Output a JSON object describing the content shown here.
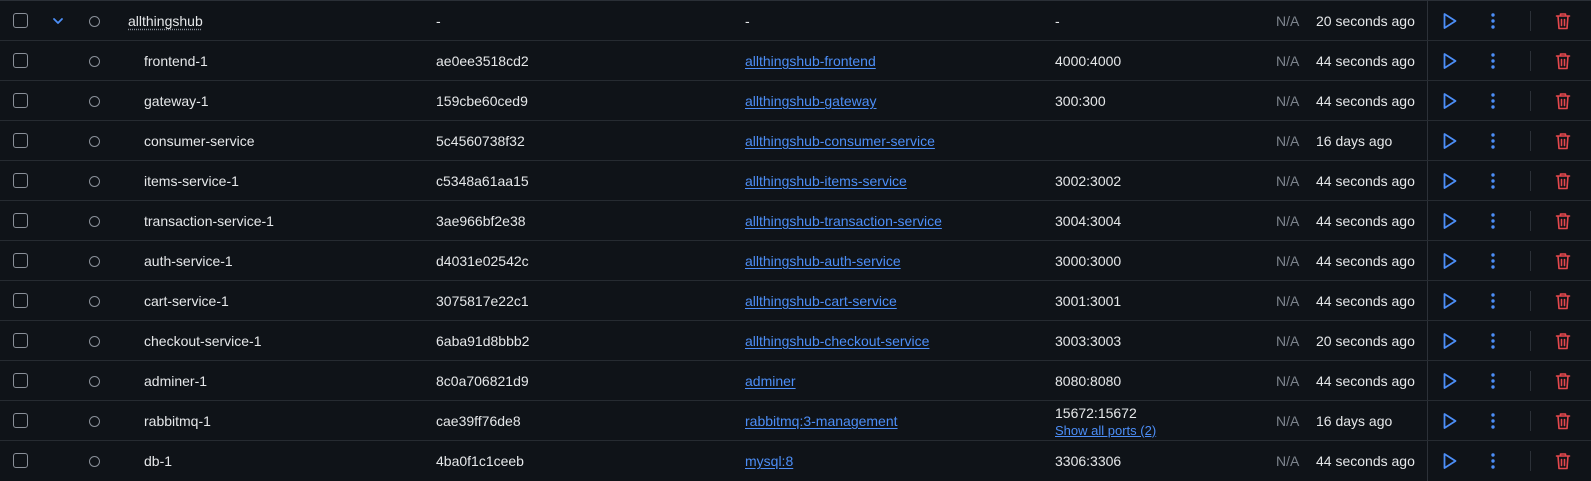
{
  "colors": {
    "background": "#0f1318",
    "link": "#4c8ef7",
    "play_icon": "#4c8ef7",
    "delete_icon": "#e5484d",
    "muted": "#7d848d"
  },
  "rows": [
    {
      "name": "allthingshub",
      "container_id": "-",
      "image": "-",
      "image_is_link": false,
      "ports": "-",
      "show_all_ports": "",
      "cpu": "N/A",
      "created": "20 seconds ago",
      "is_group": true
    },
    {
      "name": "frontend-1",
      "container_id": "ae0ee3518cd2",
      "image": "allthingshub-frontend",
      "image_is_link": true,
      "ports": "4000:4000",
      "show_all_ports": "",
      "cpu": "N/A",
      "created": "44 seconds ago",
      "is_group": false
    },
    {
      "name": "gateway-1",
      "container_id": "159cbe60ced9",
      "image": "allthingshub-gateway",
      "image_is_link": true,
      "ports": "300:300",
      "show_all_ports": "",
      "cpu": "N/A",
      "created": "44 seconds ago",
      "is_group": false
    },
    {
      "name": "consumer-service",
      "container_id": "5c4560738f32",
      "image": "allthingshub-consumer-service",
      "image_is_link": true,
      "ports": "",
      "show_all_ports": "",
      "cpu": "N/A",
      "created": "16 days ago",
      "is_group": false
    },
    {
      "name": "items-service-1",
      "container_id": "c5348a61aa15",
      "image": "allthingshub-items-service",
      "image_is_link": true,
      "ports": "3002:3002",
      "show_all_ports": "",
      "cpu": "N/A",
      "created": "44 seconds ago",
      "is_group": false
    },
    {
      "name": "transaction-service-1",
      "container_id": "3ae966bf2e38",
      "image": "allthingshub-transaction-service",
      "image_is_link": true,
      "ports": "3004:3004",
      "show_all_ports": "",
      "cpu": "N/A",
      "created": "44 seconds ago",
      "is_group": false
    },
    {
      "name": "auth-service-1",
      "container_id": "d4031e02542c",
      "image": "allthingshub-auth-service",
      "image_is_link": true,
      "ports": "3000:3000",
      "show_all_ports": "",
      "cpu": "N/A",
      "created": "44 seconds ago",
      "is_group": false
    },
    {
      "name": "cart-service-1",
      "container_id": "3075817e22c1",
      "image": "allthingshub-cart-service",
      "image_is_link": true,
      "ports": "3001:3001",
      "show_all_ports": "",
      "cpu": "N/A",
      "created": "44 seconds ago",
      "is_group": false
    },
    {
      "name": "checkout-service-1",
      "container_id": "6aba91d8bbb2",
      "image": "allthingshub-checkout-service",
      "image_is_link": true,
      "ports": "3003:3003",
      "show_all_ports": "",
      "cpu": "N/A",
      "created": "20 seconds ago",
      "is_group": false
    },
    {
      "name": "adminer-1",
      "container_id": "8c0a706821d9",
      "image": "adminer",
      "image_is_link": true,
      "ports": "8080:8080",
      "show_all_ports": "",
      "cpu": "N/A",
      "created": "44 seconds ago",
      "is_group": false
    },
    {
      "name": "rabbitmq-1",
      "container_id": "cae39ff76de8",
      "image": "rabbitmq:3-management",
      "image_is_link": true,
      "ports": "15672:15672",
      "show_all_ports": "Show all ports (2)",
      "cpu": "N/A",
      "created": "16 days ago",
      "is_group": false
    },
    {
      "name": "db-1",
      "container_id": "4ba0f1c1ceeb",
      "image": "mysql:8",
      "image_is_link": true,
      "ports": "3306:3306",
      "show_all_ports": "",
      "cpu": "N/A",
      "created": "44 seconds ago",
      "is_group": false
    }
  ],
  "icons": {
    "expand": "chevron-down-icon",
    "status": "circle-icon",
    "start": "play-icon",
    "more": "kebab-menu-icon",
    "delete": "trash-icon"
  }
}
